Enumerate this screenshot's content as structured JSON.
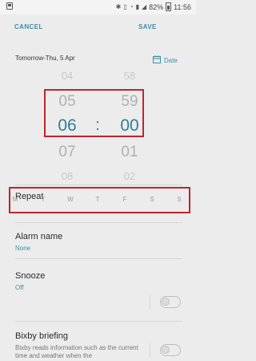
{
  "status_bar": {
    "left_icon": "gallery-notification-icon",
    "battery_percent": "82%",
    "time": "11:56"
  },
  "action_bar": {
    "cancel_label": "CANCEL",
    "save_label": "SAVE"
  },
  "date_row": {
    "label": "Tomorrow-Thu, 5 Apr",
    "date_button_label": "Date"
  },
  "time_picker": {
    "hours": [
      "04",
      "05",
      "06",
      "07",
      "08"
    ],
    "minutes": [
      "58",
      "59",
      "00",
      "01",
      "02"
    ],
    "selected_hour": "06",
    "selected_minute": "00",
    "separator": ":"
  },
  "repeat": {
    "title": "Repeat",
    "days": [
      "M",
      "T",
      "W",
      "T",
      "F",
      "S",
      "S"
    ]
  },
  "settings": {
    "alarm_name": {
      "title": "Alarm name",
      "value": "None"
    },
    "snooze": {
      "title": "Snooze",
      "value": "Off",
      "enabled": false
    },
    "bixby": {
      "title": "Bixby briefing",
      "description": "Bixby reads information such as the current time and weather when the",
      "enabled": false
    }
  },
  "colors": {
    "accent": "#3d8fa5",
    "highlight": "#c0242e",
    "background": "#ececec"
  }
}
